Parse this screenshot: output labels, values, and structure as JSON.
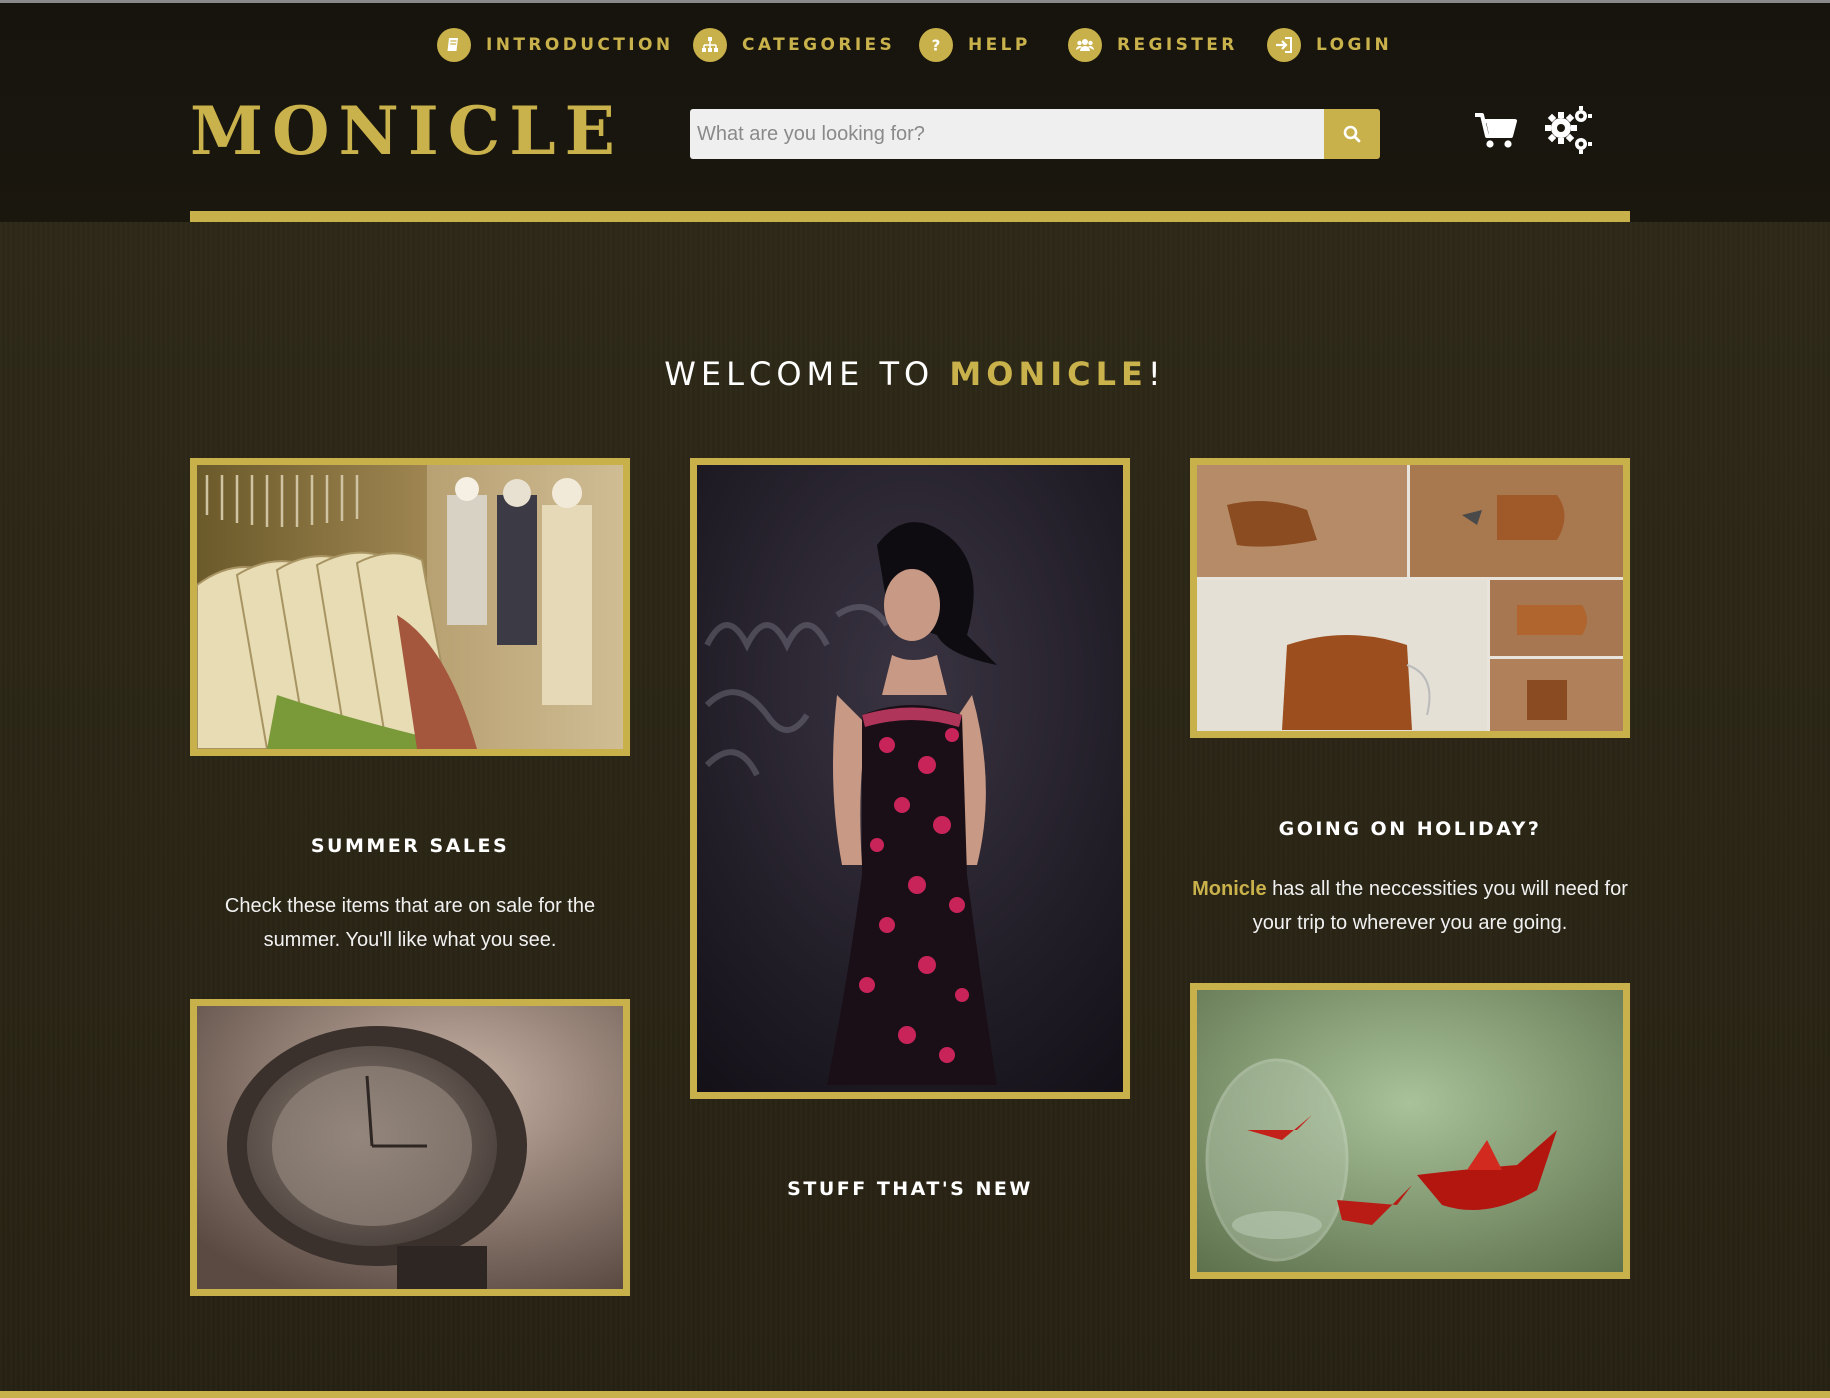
{
  "nav": {
    "items": [
      {
        "label": "INTRODUCTION",
        "icon": "book-icon"
      },
      {
        "label": "CATEGORIES",
        "icon": "sitemap-icon"
      },
      {
        "label": "HELP",
        "icon": "question-icon"
      },
      {
        "label": "REGISTER",
        "icon": "users-icon"
      },
      {
        "label": "LOGIN",
        "icon": "sign-in-icon"
      }
    ]
  },
  "header": {
    "logo": "MONICLE",
    "search": {
      "placeholder": "What are you looking for?",
      "value": ""
    },
    "icons": [
      "search-icon",
      "cart-icon",
      "gears-icon"
    ]
  },
  "welcome": {
    "prefix": "WELCOME TO ",
    "brand": "MONICLE",
    "suffix": "!"
  },
  "sections": {
    "summer": {
      "title": "SUMMER SALES",
      "text": "Check these items that are on sale for the summer. You'll like what you see."
    },
    "new": {
      "title": "STUFF THAT'S NEW"
    },
    "holiday": {
      "title": "GOING ON HOLIDAY?",
      "brand": "Monicle",
      "text": " has all the neccessities you will need for your trip to wherever you are going."
    }
  },
  "colors": {
    "accent": "#c8b04a",
    "header_bg": "#16140d",
    "body_bg": "#2b2616",
    "text": "#ffffff"
  }
}
